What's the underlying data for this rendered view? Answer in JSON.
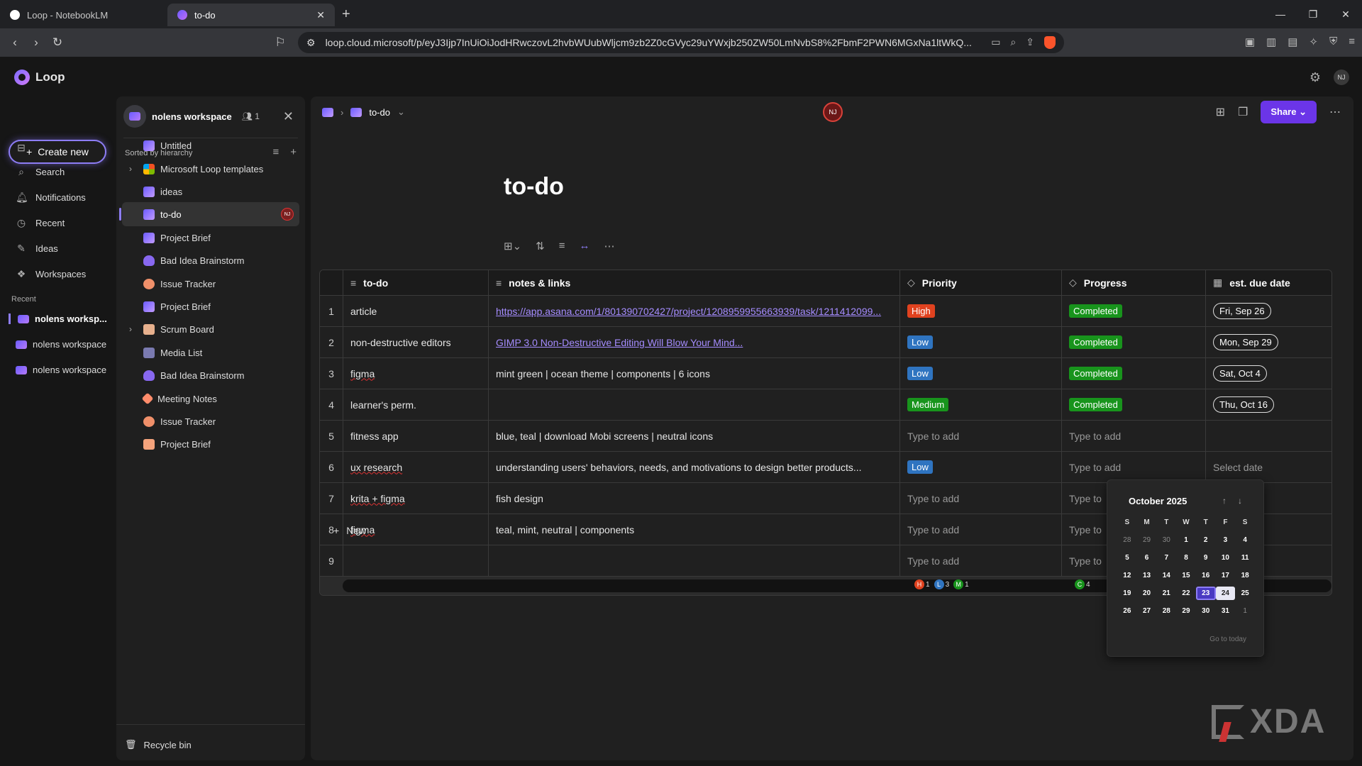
{
  "browser": {
    "tabs": [
      {
        "title": "Loop - NotebookLM",
        "icon": "notebooklm-icon"
      },
      {
        "title": "to-do",
        "icon": "loop-icon"
      }
    ],
    "url": "loop.cloud.microsoft/p/eyJ3Ijp7InUiOiJodHRwczovL2hvbWUubWljcm9zb2Z0cGVyc29uYWxjb250ZW50LmNvbS8%2FbmF2PWN6MGxNa1ltWkQ..."
  },
  "app": {
    "name": "Loop",
    "user_initials": "NJ",
    "create_label": "Create new",
    "nav": [
      {
        "label": "Search",
        "icon": "search-icon"
      },
      {
        "label": "Notifications",
        "icon": "bell-icon"
      },
      {
        "label": "Recent",
        "icon": "clock-icon"
      },
      {
        "label": "Ideas",
        "icon": "ideas-icon"
      },
      {
        "label": "Workspaces",
        "icon": "workspaces-icon"
      }
    ],
    "recent_label": "Recent",
    "recent": [
      {
        "label": "nolens worksp..."
      },
      {
        "label": "nolens workspace"
      },
      {
        "label": "nolens workspace"
      }
    ]
  },
  "workspace": {
    "name": "nolens workspace",
    "members": "1",
    "sorted_label": "Sorted by hierarchy",
    "items": [
      {
        "label": "Untitled",
        "icon": "loop"
      },
      {
        "label": "Microsoft Loop templates",
        "icon": "ms"
      },
      {
        "label": "ideas",
        "icon": "loop"
      },
      {
        "label": "to-do",
        "icon": "loop"
      },
      {
        "label": "Project Brief",
        "icon": "loop"
      },
      {
        "label": "Bad Idea Brainstorm",
        "icon": "bulb"
      },
      {
        "label": "Issue Tracker",
        "icon": "person"
      },
      {
        "label": "Project Brief",
        "icon": "loop"
      },
      {
        "label": "Scrum Board",
        "icon": "scrum"
      },
      {
        "label": "Media List",
        "icon": "media"
      },
      {
        "label": "Bad Idea Brainstorm",
        "icon": "bulb"
      },
      {
        "label": "Meeting Notes",
        "icon": "pen"
      },
      {
        "label": "Issue Tracker",
        "icon": "person"
      },
      {
        "label": "Project Brief",
        "icon": "doc"
      }
    ],
    "active_initials": "NJ",
    "recycle_label": "Recycle bin"
  },
  "page": {
    "breadcrumb": "to-do",
    "collaborator": "NJ",
    "share_label": "Share",
    "title": "to-do"
  },
  "table": {
    "columns": [
      "to-do",
      "notes & links",
      "Priority",
      "Progress",
      "est. due date"
    ],
    "rows": [
      {
        "num": "1",
        "todo": "article",
        "notes": "https://app.asana.com/1/801390702427/project/1208959955663939/task/1211412099...",
        "notes_link": true,
        "priority": "High",
        "progress": "Completed",
        "due": "Fri, Sep 26"
      },
      {
        "num": "2",
        "todo": "non-destructive editors",
        "notes": "GIMP 3.0 Non-Destructive Editing Will Blow Your Mind...",
        "notes_link": true,
        "priority": "Low",
        "progress": "Completed",
        "due": "Mon, Sep 29"
      },
      {
        "num": "3",
        "todo": "figma",
        "notes": "mint green | ocean theme | components | 6 icons",
        "priority": "Low",
        "progress": "Completed",
        "due": "Sat, Oct 4"
      },
      {
        "num": "4",
        "todo": "learner's perm.",
        "notes": "",
        "priority": "Medium",
        "progress": "Completed",
        "due": "Thu, Oct 16"
      },
      {
        "num": "5",
        "todo": "fitness app",
        "notes": "blue, teal | download Mobi screens | neutral icons",
        "priority": "",
        "progress": "",
        "due": ""
      },
      {
        "num": "6",
        "todo": "ux research",
        "notes": "understanding users' behaviors, needs, and motivations to design better products...",
        "priority": "Low",
        "progress": "",
        "due": "Select date"
      },
      {
        "num": "7",
        "todo": "krita + figma",
        "notes": "fish design",
        "priority": "",
        "progress": "",
        "due": ""
      },
      {
        "num": "8",
        "todo": "figma",
        "notes": "teal, mint, neutral | components",
        "priority": "",
        "progress": "",
        "due": ""
      },
      {
        "num": "9",
        "todo": "",
        "notes": "",
        "priority": "",
        "progress": "",
        "due": ""
      }
    ],
    "placeholder": "Type to add",
    "progress_placeholder_short": "Type to",
    "summary": {
      "priority": [
        {
          "k": "H",
          "n": "1",
          "color": "#e0421f"
        },
        {
          "k": "L",
          "n": "3",
          "color": "#2f74c0"
        },
        {
          "k": "M",
          "n": "1",
          "color": "#18941c"
        }
      ],
      "progress": [
        {
          "k": "C",
          "n": "4",
          "color": "#18941c"
        }
      ]
    },
    "new_label": "New"
  },
  "calendar": {
    "month": "October 2025",
    "dow": [
      "S",
      "M",
      "T",
      "W",
      "T",
      "F",
      "S"
    ],
    "weeks": [
      [
        "28",
        "29",
        "30",
        "1",
        "2",
        "3",
        "4"
      ],
      [
        "5",
        "6",
        "7",
        "8",
        "9",
        "10",
        "11"
      ],
      [
        "12",
        "13",
        "14",
        "15",
        "16",
        "17",
        "18"
      ],
      [
        "19",
        "20",
        "21",
        "22",
        "23",
        "24",
        "25"
      ],
      [
        "26",
        "27",
        "28",
        "29",
        "30",
        "31",
        "1"
      ]
    ],
    "today": "23",
    "hovered": "24",
    "goto_label": "Go to today"
  },
  "watermark": "XDA"
}
